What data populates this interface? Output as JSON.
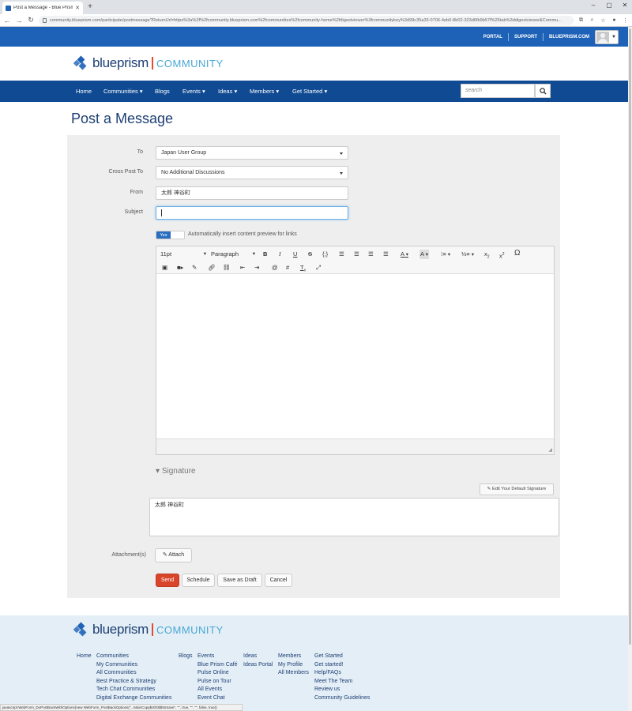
{
  "browser": {
    "tab_title": "Post a Message - Blue Prism Co",
    "url": "community.blueprism.com/participate/postmessage?ReturnUrl=https%3a%2f%2fcommunity.blueprism.com%2fcommunities%2fcommunity-home%2fdigestviewer%3fcommunitykey%3d99c35a33-0706-4eb0-8b02-323d6fb9b57f%26tab%3ddigestviewer&Commu...",
    "status_text": "javascript:WebForm_DoPostBackWithOptions(new WebForm_PostBackOptions(\"...MainCopy$ctl03$btnSave\", \"\", true, \"\", \"\", false, true))"
  },
  "topbar": {
    "portal": "PORTAL",
    "support": "SUPPORT",
    "site": "BLUEPRISM.COM"
  },
  "logo": {
    "word": "blueprism",
    "suffix": "COMMUNITY"
  },
  "nav": {
    "items": [
      "Home",
      "Communities",
      "Blogs",
      "Events",
      "Ideas",
      "Members",
      "Get Started"
    ],
    "search_placeholder": "search"
  },
  "page": {
    "title": "Post a Message"
  },
  "form": {
    "to_label": "To",
    "to_value": "Japan User Group",
    "crosspost_label": "Cross Post To",
    "crosspost_value": "No Additional Discussions",
    "from_label": "From",
    "from_value": "太郎 神谷町",
    "subject_label": "Subject",
    "subject_value": "",
    "toggle_on": "Yes",
    "toggle_label": "Automatically insert content preview for links",
    "fontsize": "11pt",
    "block": "Paragraph",
    "signature_heading": "Signature",
    "edit_signature": "Edit Your Default Signature",
    "signature_text": "太郎 神谷町",
    "attachments_label": "Attachment(s)",
    "attach": "Attach",
    "send": "Send",
    "schedule": "Schedule",
    "save_draft": "Save as Draft",
    "cancel": "Cancel"
  },
  "footer": {
    "col1": [
      "Home"
    ],
    "col2": [
      "Communities",
      "My Communities",
      "All Communities",
      "Best Practice & Strategy",
      "Tech Chat Communities",
      "Digital Exchange Communities"
    ],
    "col3": [
      "Blogs"
    ],
    "col4": [
      "Events",
      "Blue Prism Café",
      "Pulse Online",
      "Pulse on Tour",
      "All Events",
      "Event Chat"
    ],
    "col5": [
      "Ideas",
      "Ideas Portal"
    ],
    "col6": [
      "Members",
      "My Profile",
      "All Members"
    ],
    "col7": [
      "Get Started",
      "Get started!",
      "Help/FAQs",
      "Meet The Team",
      "Review us",
      "Community Guidelines"
    ]
  },
  "colors": {
    "brand_blue": "#1e62b8",
    "nav_blue": "#0f4a93",
    "send_red": "#d9452b",
    "accent_orange": "#e8482b"
  }
}
